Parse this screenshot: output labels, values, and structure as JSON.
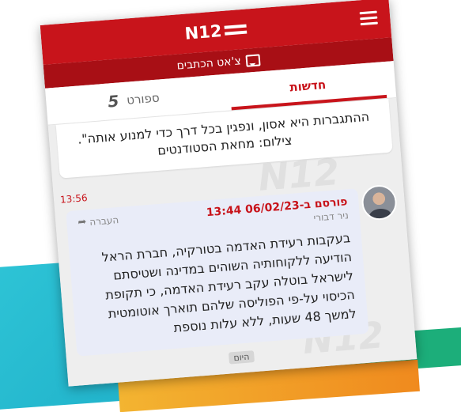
{
  "header": {
    "logo_text": "N12",
    "menu_icon": "hamburger-menu-icon",
    "subtitle": "צ'אט הכתבים",
    "subtitle_icon": "chat-icon"
  },
  "tabs": [
    {
      "label": "חדשות",
      "active": true
    },
    {
      "label": "ספורט",
      "active": false,
      "icon": "sport-5-icon"
    }
  ],
  "prev_message": {
    "text": "ההתגברות היא אסון, ונפגין בכל דרך כדי למנוע אותה\". צילום: מחאת הסטודנטים",
    "time": "13:56"
  },
  "message": {
    "published": "פורסם ב-06/02/23 13:44",
    "author": "ניר דבורי",
    "forward_label": "העברה",
    "body": "בעקבות רעידת האדמה בטורקיה, חברת הראל הודיעה ללקוחותיה השוהים במדינה ושטיסתם לישראל בוטלה עקב רעידת האדמה, כי תקופת הכיסוי על-פי הפוליסה שלהם תוארך אוטומטית למשך 48 שעות, ללא עלות נוספת"
  },
  "date_divider": "היום",
  "colors": {
    "brand_red": "#c8141b",
    "subbar_red": "#a80f15",
    "bubble_bg": "#e9ecf8"
  }
}
